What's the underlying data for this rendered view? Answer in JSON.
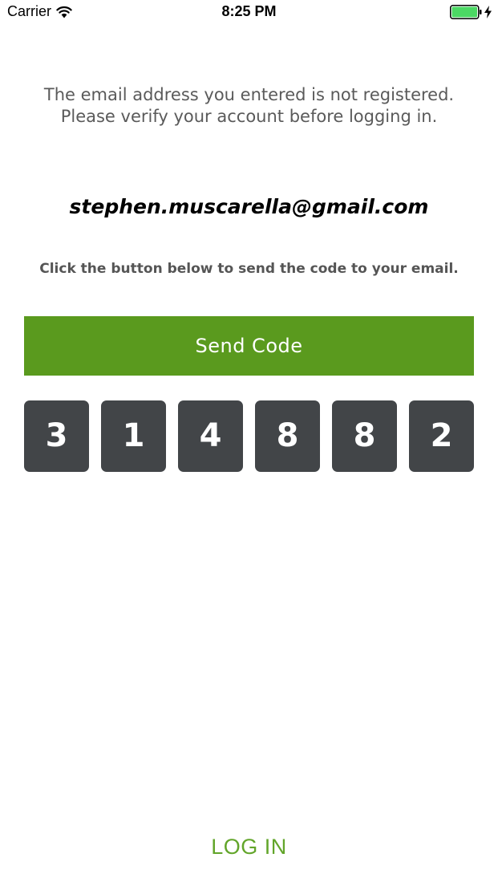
{
  "status_bar": {
    "carrier": "Carrier",
    "time": "8:25 PM",
    "battery_color": "#4cd964"
  },
  "message": {
    "line1": "The email address you entered is not registered.",
    "line2": "Please verify your account before logging in."
  },
  "email": "stephen.muscarella@gmail.com",
  "instruction": "Click the button below to send the code to your email.",
  "send_button": {
    "label": "Send Code",
    "color": "#5a9a1e"
  },
  "code_digits": [
    "3",
    "1",
    "4",
    "8",
    "8",
    "2"
  ],
  "code_box_color": "#424548",
  "login_link": {
    "label": "LOG IN",
    "color": "#62a52a"
  }
}
